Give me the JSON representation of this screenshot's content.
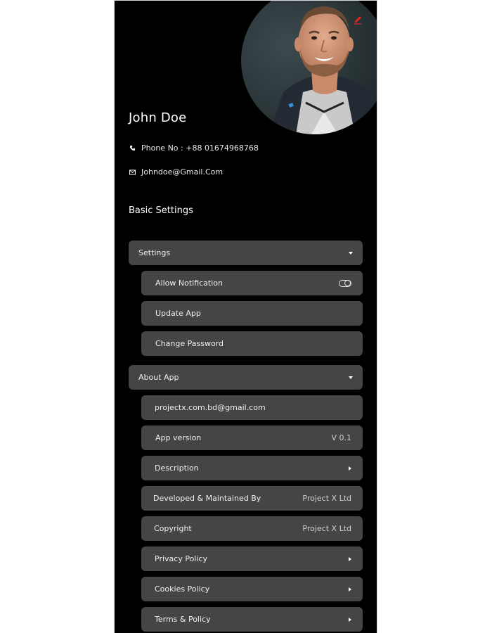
{
  "profile": {
    "name": "John Doe",
    "phone": "Phone No : +88 01674968768",
    "email": "Johndoe@Gmail.Com"
  },
  "section_title": "Basic Settings",
  "settings": {
    "label": "Settings",
    "items": [
      {
        "label": "Allow Notification"
      },
      {
        "label": "Update App"
      },
      {
        "label": "Change Password"
      }
    ]
  },
  "about": {
    "label": "About App",
    "items": [
      {
        "label": "projectx.com.bd@gmail.com"
      },
      {
        "label": "App version",
        "value": "V 0.1"
      },
      {
        "label": "Description"
      },
      {
        "label": "Developed & Maintained By",
        "value": "Project X Ltd"
      },
      {
        "label": "Copyright",
        "value": "Project X Ltd"
      },
      {
        "label": "Privacy Policy"
      },
      {
        "label": "Cookies Policy"
      },
      {
        "label": "Terms & Policy"
      }
    ]
  },
  "colors": {
    "background": "#000000",
    "card": "#454545",
    "edit_accent": "#e02424"
  },
  "icons": {
    "edit": "pencil-icon",
    "phone": "phone-icon",
    "email": "mail-icon",
    "toggle": "toggle-icon",
    "expand": "chevron-down-icon",
    "navigate": "chevron-right-icon"
  }
}
